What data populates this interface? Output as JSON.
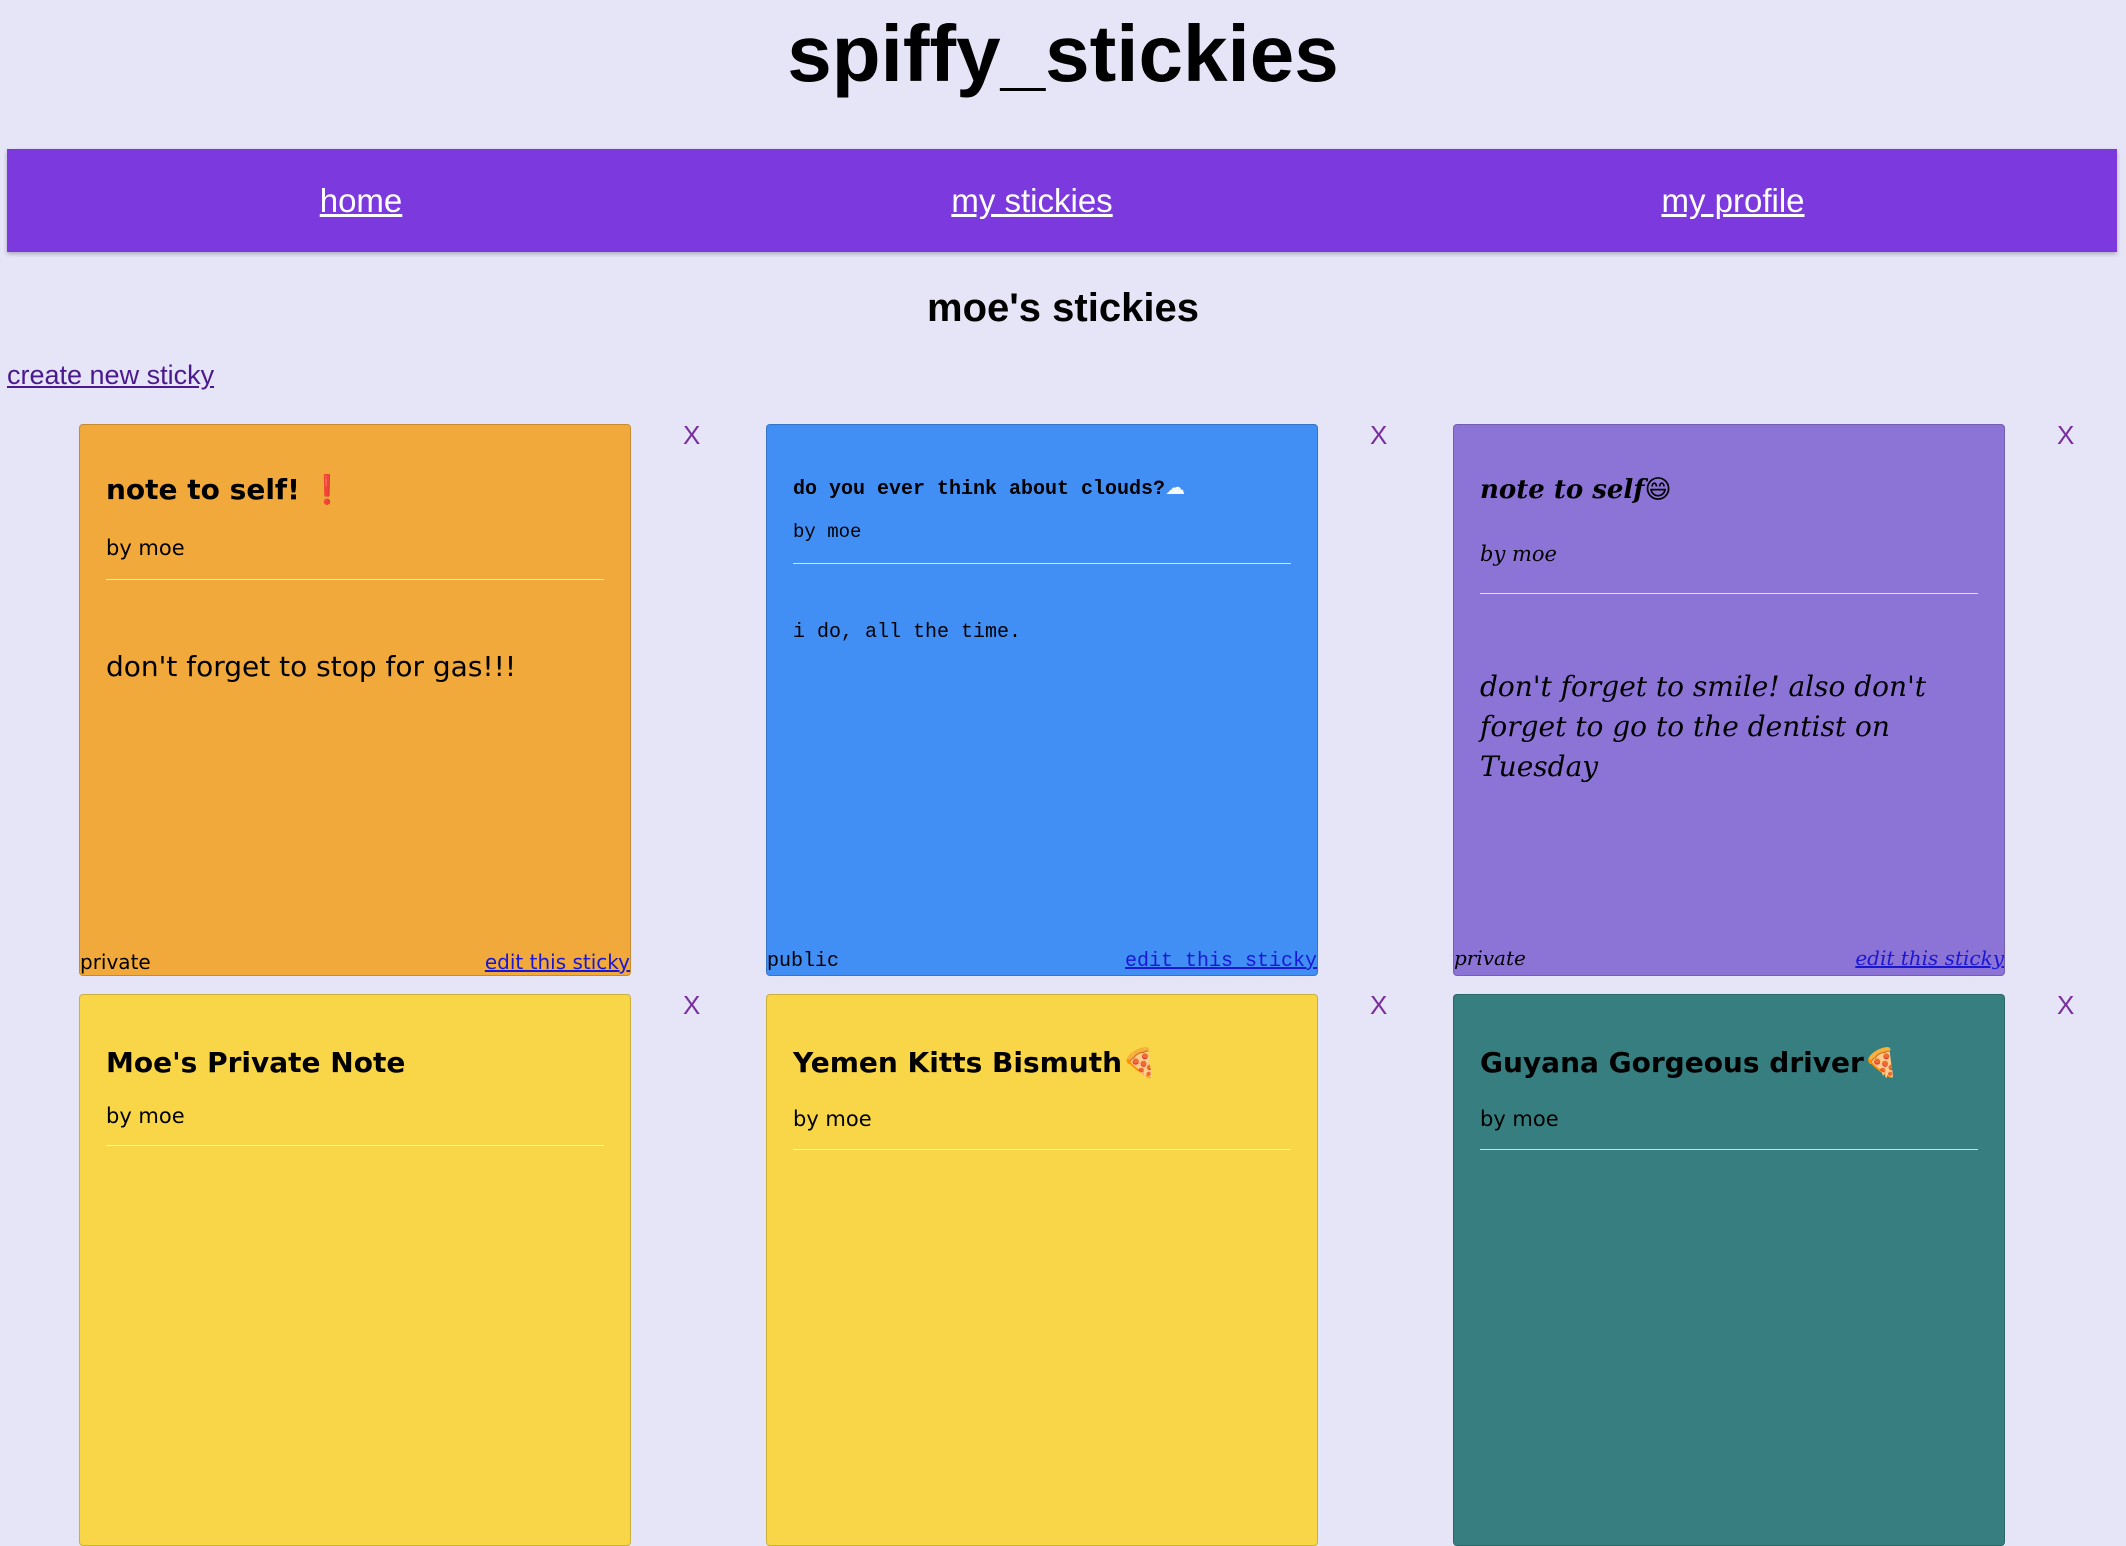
{
  "site": {
    "title": "spiffy_stickies"
  },
  "nav": {
    "home": "home",
    "my_stickies": "my stickies",
    "my_profile": "my profile"
  },
  "page": {
    "heading": "moe's stickies",
    "create_link": "create new sticky"
  },
  "colors": {
    "background": "#e6e4f7",
    "nav": "#7c3ade",
    "orange": "#f2a93b",
    "blue": "#418ff5",
    "purple": "#8c74d6",
    "yellow": "#f8d648",
    "teal": "#367e7f"
  },
  "close_label": "X",
  "stickies": [
    {
      "title": "note to self!",
      "title_icon": "❗",
      "author": "by moe",
      "body": "don't forget to stop for gas!!!",
      "privacy": "private",
      "edit_label": "edit this sticky",
      "color": "#f2a93b",
      "font": "sans"
    },
    {
      "title": "do you ever think about clouds?",
      "title_icon": "☁",
      "author": "by moe",
      "body": "i do, all the time.",
      "privacy": "public",
      "edit_label": "edit this sticky",
      "color": "#418ff5",
      "font": "mono"
    },
    {
      "title": "note to self",
      "title_icon": "😄",
      "author": "by moe",
      "body": "don't forget to smile! also don't forget to go to the dentist on Tuesday",
      "privacy": "private",
      "edit_label": "edit this sticky",
      "color": "#8c74d6",
      "font": "script"
    },
    {
      "title": "Moe's Private Note",
      "title_icon": "",
      "author": "by moe",
      "color": "#f8d648",
      "font": "sans"
    },
    {
      "title": "Yemen Kitts Bismuth",
      "title_icon": "🍕",
      "author": "by moe",
      "color": "#f8d648",
      "font": "sans"
    },
    {
      "title": "Guyana Gorgeous driver",
      "title_icon": "🍕",
      "author": "by moe",
      "color": "#367e7f",
      "font": "sans"
    }
  ]
}
